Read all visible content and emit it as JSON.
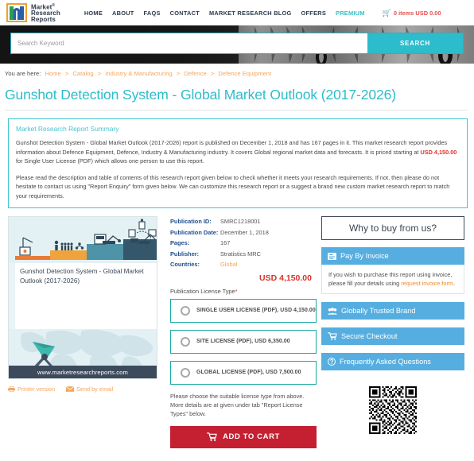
{
  "header": {
    "logo": {
      "line1": "Market",
      "line2": "Research",
      "line3": "Reports",
      "reg": "®"
    },
    "nav": [
      {
        "label": "HOME",
        "id": "home"
      },
      {
        "label": "ABOUT",
        "id": "about"
      },
      {
        "label": "FAQS",
        "id": "faqs"
      },
      {
        "label": "CONTACT",
        "id": "contact"
      },
      {
        "label": "MARKET RESEARCH BLOG",
        "id": "blog"
      },
      {
        "label": "OFFERS",
        "id": "offers"
      },
      {
        "label": "PREMIUM",
        "id": "premium"
      }
    ],
    "cart": {
      "icon": "cart-icon",
      "label": "0 items USD 0.00"
    }
  },
  "search": {
    "placeholder": "Search Keyword",
    "value": "",
    "button_label": "SEARCH"
  },
  "breadcrumb": {
    "lead": "You are here:",
    "items": [
      "Home",
      "Catalog",
      "Industry & Manufacturing",
      "Defence",
      "Defence Equipment"
    ],
    "separator": ">"
  },
  "page_title": "Gunshot Detection System - Global Market Outlook (2017-2026)",
  "summary": {
    "heading": "Market Research Report Summary",
    "para1_a": "Gunshot Detection System - Global Market Outlook (2017-2026) report is published on December 1, 2018 and has 167 pages in it. This market research report provides information about Defence Equipment, Defence, Industry & Manufacturing industry. It covers Global regional market data and forecasts. It is priced starting at ",
    "para1_price": "USD 4,150.00",
    "para1_b": " for Single User License (PDF) which allows one person to use this report.",
    "para2": "Please read the description and table of contents of this research report given below to check whether it meets your research requirements. If not, then please do not hesitate to contact us using \"Report Enquiry\" form given below. We can customize this research report or a suggest a brand new custom market research report to match your requirements."
  },
  "thumbnail": {
    "caption": "Gunshot Detection System - Global Market Outlook (2017-2026)",
    "url_label": "www.marketresearchreports.com"
  },
  "small_links": [
    {
      "label": "Printer version",
      "icon": "printer-icon"
    },
    {
      "label": "Send by email",
      "icon": "email-icon"
    }
  ],
  "meta": [
    {
      "key": "Publication ID:",
      "value": "SMRC1218001",
      "is_link": false
    },
    {
      "key": "Publication Date:",
      "value": "December 1, 2018",
      "is_link": false
    },
    {
      "key": "Pages:",
      "value": "167",
      "is_link": false
    },
    {
      "key": "Publisher:",
      "value": "Stratistics MRC",
      "is_link": false
    },
    {
      "key": "Countries:",
      "value": "Global",
      "is_link": true
    }
  ],
  "big_price": "USD 4,150.00",
  "license": {
    "label": "Publication License Type",
    "required_mark": "*",
    "options": [
      {
        "label": "SINGLE USER LICENSE (PDF), USD 4,150.00",
        "selected": false
      },
      {
        "label": "SITE LICENSE (PDF), USD 6,350.00",
        "selected": false
      },
      {
        "label": "GLOBAL LICENSE (PDF), USD 7,500.00",
        "selected": false
      }
    ],
    "note": "Please choose the suitable license type from above. More details are at given under tab \"Report License Types\" below."
  },
  "add_to_cart": {
    "label": "ADD TO CART",
    "icon": "cart-icon",
    "color": "#c42032"
  },
  "sidebar": {
    "why_buy_title": "Why to buy from us?",
    "pay_by_invoice": {
      "title": "Pay By Invoice",
      "icon": "invoice-icon",
      "body_a": "If you wish to purchase this report using invoice, please fill your details using ",
      "body_link": "request invoice form",
      "body_b": "."
    },
    "bars": [
      {
        "label": "Globally Trusted Brand",
        "icon": "people-icon"
      },
      {
        "label": "Secure Checkout",
        "icon": "cart-icon"
      },
      {
        "label": "Frequently Asked Questions",
        "icon": "question-icon"
      }
    ],
    "qr": {
      "name": "qr-code"
    }
  },
  "colors": {
    "teal": "#2cbccb",
    "orange": "#f5a65b",
    "red": "#d9342b",
    "blue": "#56aee0",
    "dark": "#3d4a5c",
    "cart_red": "#c42032"
  }
}
